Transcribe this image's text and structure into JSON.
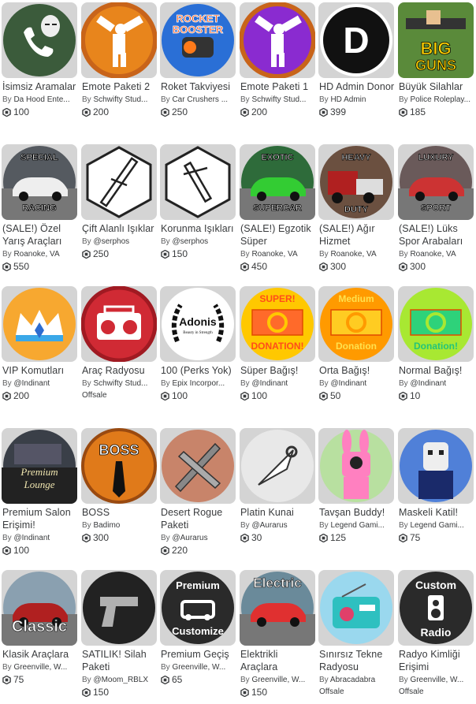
{
  "items": [
    {
      "name": "İsimsiz Aramalar",
      "creator": "Da Hood Ente...",
      "price": "100",
      "offsale": "",
      "bg": "#3b5b3b",
      "fg": "#ffffff",
      "icon": "phone-mask-icon",
      "label": ""
    },
    {
      "name": "Emote Paketi 2",
      "creator": "Schwifty Stud...",
      "price": "200",
      "offsale": "",
      "bg": "#e8851c",
      "fg": "#ffffff",
      "icon": "dab-figure-icon",
      "label": ""
    },
    {
      "name": "Roket Takviyesi",
      "creator": "Car Crushers ...",
      "price": "250",
      "offsale": "",
      "bg": "#2a6fd6",
      "fg": "#ff7a1a",
      "icon": "rocket-booster-icon",
      "label": "ROCKET BOOSTER"
    },
    {
      "name": "Emote Paketi 1",
      "creator": "Schwifty Stud...",
      "price": "200",
      "offsale": "",
      "bg": "#8a2bd0",
      "fg": "#ffffff",
      "icon": "dab-figure-icon",
      "label": ""
    },
    {
      "name": "HD Admin Donor",
      "creator": "HD Admin",
      "price": "399",
      "offsale": "",
      "bg": "#111111",
      "fg": "#ffffff",
      "icon": "letter-d-icon",
      "label": "D"
    },
    {
      "name": "Büyük Silahlar",
      "creator": "Police Roleplay...",
      "price": "185",
      "offsale": "",
      "bg": "#5a8a3a",
      "fg": "#ffd000",
      "icon": "big-guns-icon",
      "label": "BIG GUNS"
    },
    {
      "name": "(SALE!) Özel Yarış Araçları",
      "creator": "Roanoke, VA",
      "price": "550",
      "offsale": "",
      "bg": "#555a60",
      "fg": "#ffffff",
      "icon": "racing-car-icon",
      "label": "SPECIAL RACING"
    },
    {
      "name": "Çift Alanlı Işıklar",
      "creator": "@serphos",
      "price": "250",
      "offsale": "",
      "bg": "#ffffff",
      "fg": "#222222",
      "icon": "double-saber-icon",
      "label": ""
    },
    {
      "name": "Korunma Işıkları",
      "creator": "@serphos",
      "price": "150",
      "offsale": "",
      "bg": "#ffffff",
      "fg": "#222222",
      "icon": "saber-hilt-icon",
      "label": ""
    },
    {
      "name": "(SALE!) Egzotik Süper",
      "creator": "Roanoke, VA",
      "price": "450",
      "offsale": "",
      "bg": "#2e6b3a",
      "fg": "#ffffff",
      "icon": "exotic-car-icon",
      "label": "EXOTIC SUPERCAR"
    },
    {
      "name": "(SALE!) Ağır Hizmet",
      "creator": "Roanoke, VA",
      "price": "300",
      "offsale": "",
      "bg": "#6b5040",
      "fg": "#ffffff",
      "icon": "heavy-truck-icon",
      "label": "HEAVY DUTY"
    },
    {
      "name": "(SALE!) Lüks Spor Arabaları",
      "creator": "Roanoke, VA",
      "price": "300",
      "offsale": "",
      "bg": "#6a5a5a",
      "fg": "#ffffff",
      "icon": "luxury-car-icon",
      "label": "LUXURY SPORT"
    },
    {
      "name": "VIP Komutları",
      "creator": "@Indinant",
      "price": "200",
      "offsale": "",
      "bg": "#f7a830",
      "fg": "#ffffff",
      "icon": "crown-icon",
      "label": ""
    },
    {
      "name": "Araç Radyosu",
      "creator": "Schwifty Stud...",
      "price": "",
      "offsale": "Offsale",
      "bg": "#d02a34",
      "fg": "#ffffff",
      "icon": "boombox-icon",
      "label": ""
    },
    {
      "name": "100 (Perks Yok)",
      "creator": "Epix Incorpor...",
      "price": "100",
      "offsale": "",
      "bg": "#ffffff",
      "fg": "#111111",
      "icon": "laurel-icon",
      "label": "Adonis"
    },
    {
      "name": "Süper Bağış!",
      "creator": "@Indinant",
      "price": "100",
      "offsale": "",
      "bg": "#ffc800",
      "fg": "#ff4d1a",
      "icon": "super-donation-icon",
      "label": "SUPER! DONATION!"
    },
    {
      "name": "Orta Bağış!",
      "creator": "@Indinant",
      "price": "50",
      "offsale": "",
      "bg": "#ff9a00",
      "fg": "#ffe14d",
      "icon": "medium-donation-icon",
      "label": "Medium Donation"
    },
    {
      "name": "Normal Bağış!",
      "creator": "@Indinant",
      "price": "10",
      "offsale": "",
      "bg": "#a8e832",
      "fg": "#22c47a",
      "icon": "normal-donation-icon",
      "label": "Donation!"
    },
    {
      "name": "Premium Salon Erişimi!",
      "creator": "@Indinant",
      "price": "100",
      "offsale": "",
      "bg": "#3a3f48",
      "fg": "#f0e6b0",
      "icon": "premium-lounge-icon",
      "label": "Premium Lounge"
    },
    {
      "name": "BOSS",
      "creator": "Badimo",
      "price": "300",
      "offsale": "",
      "bg": "#e07a1a",
      "fg": "#ffffff",
      "icon": "boss-tie-icon",
      "label": "BOSS"
    },
    {
      "name": "Desert Rogue Paketi",
      "creator": "@Aurarus",
      "price": "220",
      "offsale": "",
      "bg": "#c8846a",
      "fg": "#333333",
      "icon": "blades-icon",
      "label": ""
    },
    {
      "name": "Platin Kunai",
      "creator": "@Aurarus",
      "price": "30",
      "offsale": "",
      "bg": "#e8e8e8",
      "fg": "#555555",
      "icon": "kunai-icon",
      "label": ""
    },
    {
      "name": "Tavşan Buddy!",
      "creator": "Legend Gami...",
      "price": "125",
      "offsale": "",
      "bg": "#b8e0a0",
      "fg": "#ff80c0",
      "icon": "bunny-avatar-icon",
      "label": ""
    },
    {
      "name": "Maskeli Katil!",
      "creator": "Legend Gami...",
      "price": "75",
      "offsale": "",
      "bg": "#5080d8",
      "fg": "#ffffff",
      "icon": "masked-avatar-icon",
      "label": ""
    },
    {
      "name": "Klasik Araçlara",
      "creator": "Greenville, W...",
      "price": "75",
      "offsale": "",
      "bg": "#8aa0b0",
      "fg": "#ffffff",
      "icon": "classic-car-icon",
      "label": "Classic"
    },
    {
      "name": "SATILIK! Silah Paketi",
      "creator": "@Moom_RBLX",
      "price": "150",
      "offsale": "",
      "bg": "#222222",
      "fg": "#b0b0b0",
      "icon": "pistol-icon",
      "label": ""
    },
    {
      "name": "Premium Geçiş",
      "creator": "Greenville, W...",
      "price": "65",
      "offsale": "",
      "bg": "#2a2a2a",
      "fg": "#ffffff",
      "icon": "car-wrench-icon",
      "label": "Premium Customize"
    },
    {
      "name": "Elektrikli Araçlara",
      "creator": "Greenville, W...",
      "price": "150",
      "offsale": "",
      "bg": "#6a8a9a",
      "fg": "#ffffff",
      "icon": "electric-car-icon",
      "label": "Electric"
    },
    {
      "name": "Sınırsız Tekne Radyosu",
      "creator": "Abracadabra",
      "price": "",
      "offsale": "Offsale",
      "bg": "#9ad8ee",
      "fg": "#e0406a",
      "icon": "radio-icon",
      "label": ""
    },
    {
      "name": "Radyo Kimliği Erişimi",
      "creator": "Greenville, W...",
      "price": "",
      "offsale": "Offsale",
      "bg": "#2a2a2a",
      "fg": "#ffffff",
      "icon": "speaker-icon",
      "label": "Custom Radio"
    }
  ],
  "by_label": "By",
  "colors": {
    "text": "#393b3d",
    "card_bg": "#d4d4d4",
    "robux": "#393b3d"
  }
}
